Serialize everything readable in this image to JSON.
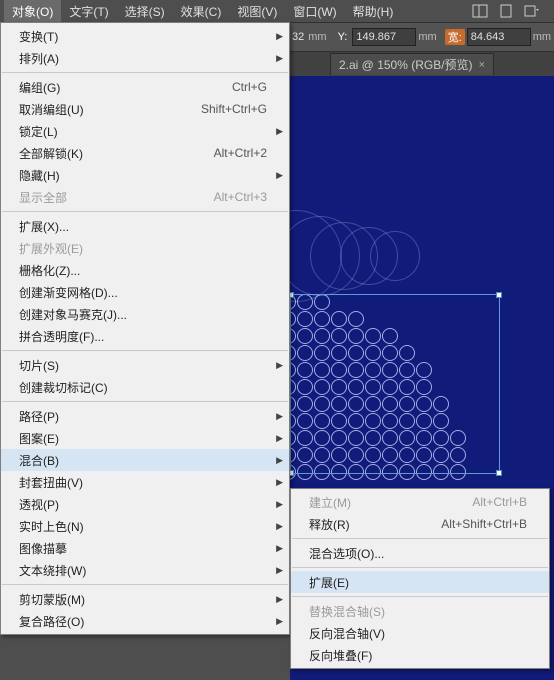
{
  "menubar": {
    "items": [
      "对象(O)",
      "文字(T)",
      "选择(S)",
      "效果(C)",
      "视图(V)",
      "窗口(W)",
      "帮助(H)"
    ]
  },
  "options": {
    "y_label": "Y:",
    "y_value": "149.867",
    "w_label": "宽:",
    "w_value": "84.643",
    "unit": "mm",
    "x_frag": "32"
  },
  "tab": {
    "title": "2.ai @ 150% (RGB/预览)"
  },
  "dd1": [
    {
      "t": "item sub",
      "l": "变换(T)"
    },
    {
      "t": "item sub",
      "l": "排列(A)"
    },
    {
      "t": "sep"
    },
    {
      "t": "item",
      "l": "编组(G)",
      "s": "Ctrl+G"
    },
    {
      "t": "item",
      "l": "取消编组(U)",
      "s": "Shift+Ctrl+G"
    },
    {
      "t": "item sub",
      "l": "锁定(L)"
    },
    {
      "t": "item",
      "l": "全部解锁(K)",
      "s": "Alt+Ctrl+2"
    },
    {
      "t": "item sub",
      "l": "隐藏(H)"
    },
    {
      "t": "item disabled",
      "l": "显示全部",
      "s": "Alt+Ctrl+3"
    },
    {
      "t": "sep"
    },
    {
      "t": "item",
      "l": "扩展(X)..."
    },
    {
      "t": "item disabled",
      "l": "扩展外观(E)"
    },
    {
      "t": "item",
      "l": "栅格化(Z)..."
    },
    {
      "t": "item",
      "l": "创建渐变网格(D)..."
    },
    {
      "t": "item",
      "l": "创建对象马赛克(J)..."
    },
    {
      "t": "item",
      "l": "拼合透明度(F)..."
    },
    {
      "t": "sep"
    },
    {
      "t": "item sub",
      "l": "切片(S)"
    },
    {
      "t": "item",
      "l": "创建裁切标记(C)"
    },
    {
      "t": "sep"
    },
    {
      "t": "item sub",
      "l": "路径(P)"
    },
    {
      "t": "item sub",
      "l": "图案(E)"
    },
    {
      "t": "item sub hover",
      "l": "混合(B)"
    },
    {
      "t": "item sub",
      "l": "封套扭曲(V)"
    },
    {
      "t": "item sub",
      "l": "透视(P)"
    },
    {
      "t": "item sub",
      "l": "实时上色(N)"
    },
    {
      "t": "item sub",
      "l": "图像描摹"
    },
    {
      "t": "item sub",
      "l": "文本绕排(W)"
    },
    {
      "t": "sep"
    },
    {
      "t": "item sub",
      "l": "剪切蒙版(M)"
    },
    {
      "t": "item sub",
      "l": "复合路径(O)"
    }
  ],
  "dd2": [
    {
      "t": "item disabled",
      "l": "建立(M)",
      "s": "Alt+Ctrl+B"
    },
    {
      "t": "item",
      "l": "释放(R)",
      "s": "Alt+Shift+Ctrl+B"
    },
    {
      "t": "sep"
    },
    {
      "t": "item",
      "l": "混合选项(O)..."
    },
    {
      "t": "sep"
    },
    {
      "t": "item hover",
      "l": "扩展(E)"
    },
    {
      "t": "sep"
    },
    {
      "t": "item disabled",
      "l": "替换混合轴(S)"
    },
    {
      "t": "item",
      "l": "反向混合轴(V)"
    },
    {
      "t": "item",
      "l": "反向堆叠(F)"
    }
  ]
}
